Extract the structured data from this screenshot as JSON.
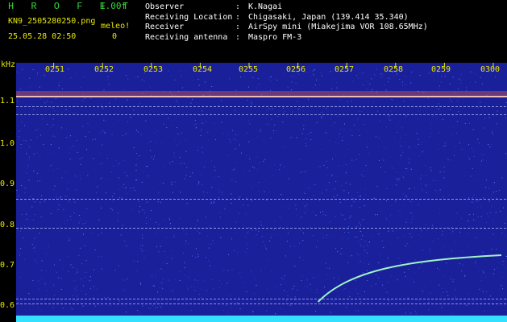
{
  "header": {
    "title": "H R O F F T",
    "version": "1.00f",
    "filename": "KN9_2505280250.png",
    "meteor_label": "meleo!",
    "datetime": "25.05.28 02:50",
    "meteor_count": "0"
  },
  "metadata": [
    {
      "key": "Observer",
      "value": "K.Nagai"
    },
    {
      "key": "Receiving Location",
      "value": "Chigasaki, Japan (139.414 35.340)"
    },
    {
      "key": "Receiver",
      "value": "AirSpy mini (Miakejima VOR 108.65MHz)"
    },
    {
      "key": "Receiving antenna",
      "value": "Maspro FM-3"
    }
  ],
  "axis": {
    "unit": "kHz",
    "y_ticks": [
      "1.1",
      "1.0",
      "0.9",
      "0.8",
      "0.7",
      "0.6"
    ],
    "x_ticks": [
      "0251",
      "0252",
      "0253",
      "0254",
      "0255",
      "0256",
      "0257",
      "0258",
      "0259",
      "0300"
    ]
  },
  "colors": {
    "background": "#1a1f9a",
    "label_yellow": "#e8e800",
    "title_green": "#39d439",
    "carrier_band": "#ff6a3c",
    "meteor_trail": "#9ff4c8",
    "noise_floor": "#33e0ff"
  },
  "chart_data": {
    "type": "heatmap",
    "y_range_khz": [
      0.58,
      1.18
    ],
    "x_range_time": [
      "0250",
      "0300"
    ],
    "horizontal_lines_khz": [
      1.12,
      1.095,
      1.075,
      0.865,
      0.793,
      0.617,
      0.605
    ],
    "meteor_trail": {
      "x_start": "0256",
      "y_start_khz": 0.61,
      "x_end": "0300",
      "y_end_khz": 0.726
    }
  }
}
